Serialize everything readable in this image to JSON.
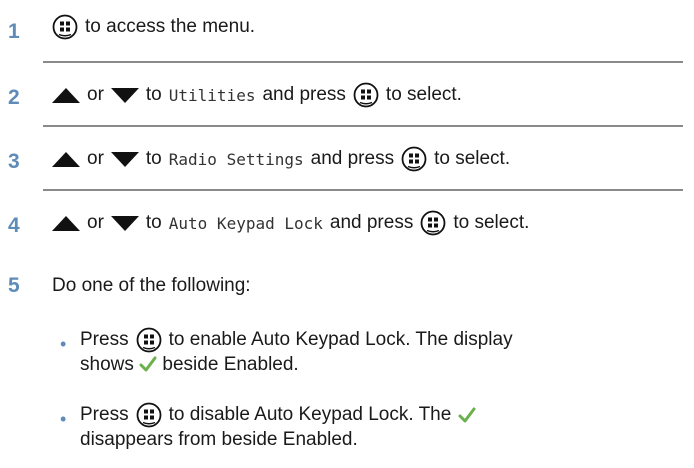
{
  "steps": [
    {
      "number": "1",
      "text": "to access the menu."
    },
    {
      "number": "2",
      "or": "or",
      "to": "to",
      "menu_item": "Utilities",
      "press": "and press",
      "after": "to select."
    },
    {
      "number": "3",
      "or": "or",
      "to": "to",
      "menu_item": "Radio Settings",
      "press": "and press",
      "after": "to select."
    },
    {
      "number": "4",
      "or": "or",
      "to": "to",
      "menu_item": "Auto Keypad Lock",
      "press": "and press",
      "after": "to select."
    },
    {
      "number": "5",
      "text": "Do one of the following:"
    }
  ],
  "options": [
    {
      "press": "Press",
      "line1": "to enable Auto Keypad Lock. The display",
      "line2_pre": "shows",
      "line2_post": "beside Enabled."
    },
    {
      "press": "Press",
      "line1_pre": "to disable Auto Keypad Lock. The",
      "line2": "disappears from beside Enabled."
    }
  ],
  "icons": {
    "menu_ok_button": "menu-ok-button-icon",
    "up": "up-arrow-icon",
    "down": "down-arrow-icon",
    "check": "checkmark-icon"
  },
  "colors": {
    "step_number": "#5e8bb8",
    "separator": "#8a8a8a",
    "check": "#6ab04c"
  }
}
